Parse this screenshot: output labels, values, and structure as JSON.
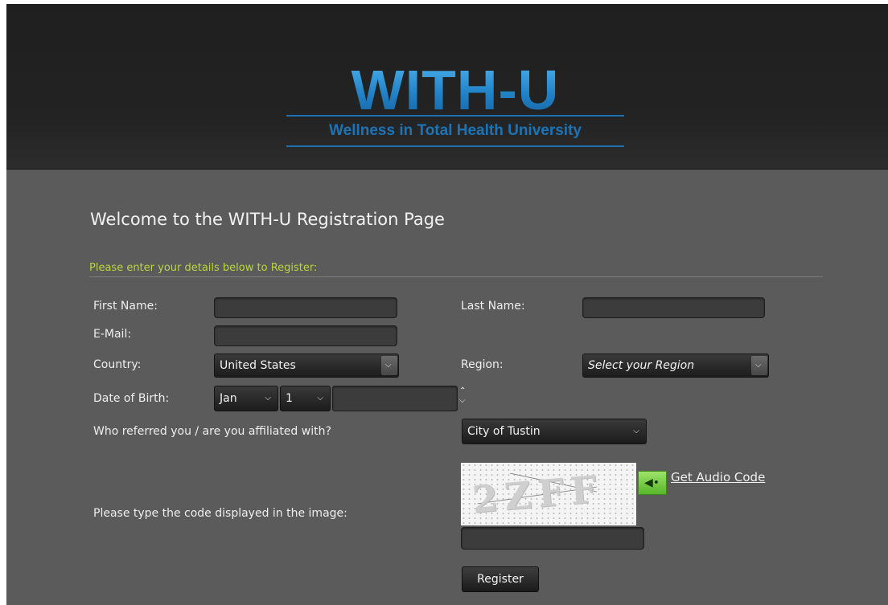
{
  "header": {
    "logo_main": "WITH-U",
    "logo_sub": "Wellness in Total Health University"
  },
  "page": {
    "title": "Welcome to the WITH-U Registration Page",
    "instruction": "Please enter your details below to Register:"
  },
  "form": {
    "first_name_label": "First Name:",
    "first_name_value": "",
    "last_name_label": "Last Name:",
    "last_name_value": "",
    "email_label": "E-Mail:",
    "email_value": "",
    "country_label": "Country:",
    "country_value": "United States",
    "region_label": "Region:",
    "region_value": "Select your Region",
    "dob_label": "Date of Birth:",
    "dob_month": "Jan",
    "dob_day": "1",
    "dob_year": "",
    "referral_label": "Who referred you / are you affiliated with?",
    "referral_value": "City of Tustin",
    "captcha_label": "Please type the code displayed in the image:",
    "captcha_text": "2ZFF",
    "captcha_value": "",
    "audio_link": "Get Audio Code",
    "register_label": "Register"
  },
  "icons": {
    "dropdown_arrow": "chevron-down-icon",
    "spinner_up": "chevron-up-icon",
    "audio": "speaker-icon"
  },
  "colors": {
    "header_bg": "#1f1f1f",
    "page_bg": "#5b5b5b",
    "logo_blue": "#2a86c6",
    "instruction_green": "#b6d83b",
    "audio_green": "#6fca3f"
  }
}
